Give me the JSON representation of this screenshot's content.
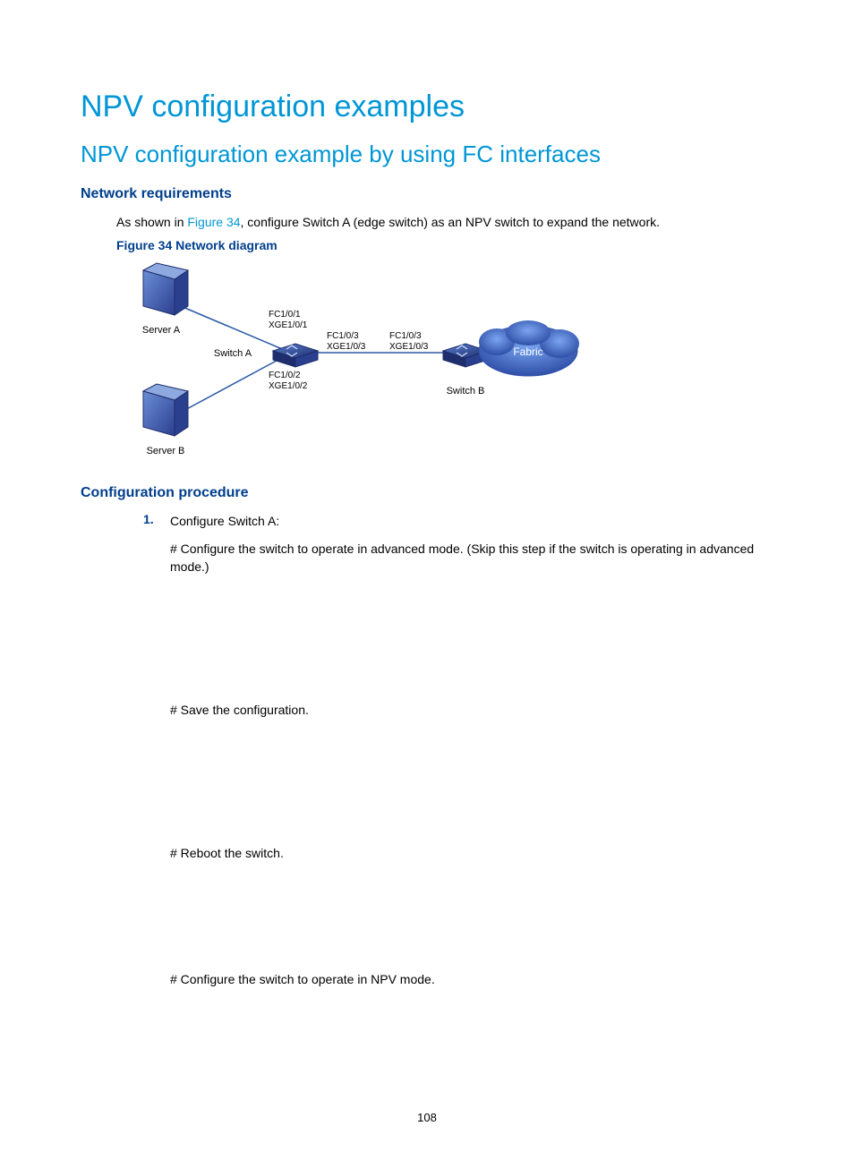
{
  "headings": {
    "h1": "NPV configuration examples",
    "h2": "NPV configuration example by using FC interfaces",
    "h3_req": "Network requirements",
    "h3_proc": "Configuration procedure",
    "figure_caption": "Figure 34 Network diagram"
  },
  "para_req_pre": "As shown in ",
  "para_req_link": "Figure 34",
  "para_req_post": ", configure Switch A (edge switch) as an NPV switch to expand the network.",
  "configure": {
    "step_num": "1.",
    "step_title": "Configure Switch A:",
    "p1": "# Configure the switch to operate in advanced mode. (Skip this step if the switch is operating in advanced mode.)",
    "p2": "# Save the configuration.",
    "p3": "# Reboot the switch.",
    "p4": "# Configure the switch to operate in NPV mode."
  },
  "diagram": {
    "server_a": "Server A",
    "server_b": "Server B",
    "switch_a": "Switch A",
    "switch_b": "Switch B",
    "fabric": "Fabric",
    "port1a": "FC1/0/1",
    "port1b": "XGE1/0/1",
    "port2a": "FC1/0/2",
    "port2b": "XGE1/0/2",
    "port3a": "FC1/0/3",
    "port3b": "XGE1/0/3",
    "port4a": "FC1/0/3",
    "port4b": "XGE1/0/3"
  },
  "page_number": "108"
}
